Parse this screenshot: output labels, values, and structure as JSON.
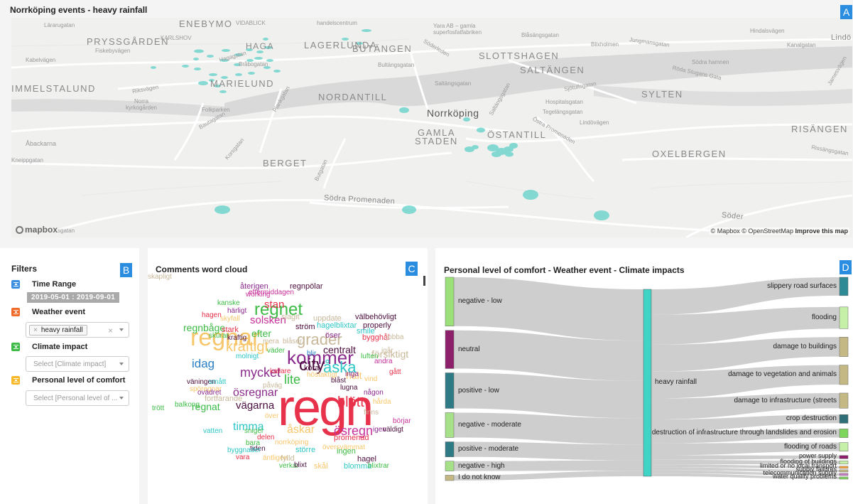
{
  "page_title": "Norrköping events - heavy rainfall",
  "badges": {
    "a": "A",
    "b": "B",
    "c": "C",
    "d": "D"
  },
  "map": {
    "labels": [
      "ENEBYMO",
      "VIDABLICK",
      "PRYSSGÅRDEN",
      "KARLSHOV",
      "HAGA",
      "LAGERLUNDA",
      "BUTÄNGEN",
      "SLOTTSHAGEN",
      "SALTÄNGEN",
      "IMMELSTALUND",
      "MARIELUND",
      "NORDANTILL",
      "SYLTEN",
      "GAMLA",
      "STADEN",
      "ÖSTANTILL",
      "RISÄNGEN",
      "OXELBERGEN",
      "BERGET",
      "Åbackarna"
    ],
    "small_labels": [
      "Lärarugatan",
      "Kabelvägen",
      "Fiskebyvägen",
      "Riksvägen",
      "Norra kyrkogården",
      "Folkparken",
      "Bråbogatan",
      "Hagagatan",
      "Kneippgatan",
      "Korsgatan",
      "Butgatan",
      "Plankgatan",
      "Sjötullsgatan",
      "Hospitalsgatan",
      "Tegelängsgatan",
      "Lindövägen",
      "Östra Promenaden",
      "Södra Promenaden",
      "Södra hamnen",
      "Röda Stugans Gata",
      "Blixholmen",
      "Jungmansgatan",
      "Bultängsgatan",
      "Saltängsgatan",
      "Rissängsgatan",
      "Kanalgatan",
      "Lindö",
      "Blåsängsgatan",
      "Söder",
      "handelscentrum",
      "Yara AB – gamla superfosfatfabriken",
      "Söderleden",
      "Hindalsvägen",
      "Jamesvägen",
      "Saltängsgatan",
      "Bautagatan",
      "Norrköping"
    ],
    "city": "Norrköping",
    "attribution_prefix": "© Mapbox © OpenStreetMap",
    "attribution_link": "Improve this map",
    "logo": "mapbox",
    "logo_tail": "sgatan",
    "point_color": "#5fd0c8"
  },
  "filters": {
    "title": "Filters",
    "time_range_label": "Time Range",
    "time_range_value": "2019-05-01 : 2019-09-01",
    "weather_label": "Weather event",
    "weather_chip": "heavy rainfall",
    "climate_label": "Climate impact",
    "climate_placeholder": "Select [Climate impact]",
    "comfort_label": "Personal level of comfort",
    "comfort_placeholder": "Select [Personal level of ..."
  },
  "wordcloud": {
    "title": "Comments word cloud",
    "words": [
      {
        "t": "regn",
        "c": "#e8314a"
      },
      {
        "t": "regnar",
        "c": "#f7c66b"
      },
      {
        "t": "regnet",
        "c": "#3dbb46"
      },
      {
        "t": "kommer",
        "c": "#8a2a8c"
      },
      {
        "t": "city",
        "c": "#4b0d3d"
      },
      {
        "t": "åska",
        "c": "#2ec6c6"
      },
      {
        "t": "grader",
        "c": "#c8b89a"
      },
      {
        "t": "blött",
        "c": "#e8314a"
      },
      {
        "t": "kraftigt",
        "c": "#f7c66b"
      },
      {
        "t": "mycket",
        "c": "#8a2a8c"
      },
      {
        "t": "lite",
        "c": "#3dbb46"
      },
      {
        "t": "solsken",
        "c": "#c8319a"
      },
      {
        "t": "stan",
        "c": "#e8314a"
      },
      {
        "t": "idag",
        "c": "#2b7fc4"
      },
      {
        "t": "efter",
        "c": "#3dbb46"
      },
      {
        "t": "centralt",
        "c": "#4b0d3d"
      },
      {
        "t": "försiktigt",
        "c": "#c8b89a"
      },
      {
        "t": "halt",
        "c": "#f7c66b"
      },
      {
        "t": "ösregnar",
        "c": "#8a2a8c"
      },
      {
        "t": "vägarna",
        "c": "#4b0d3d"
      },
      {
        "t": "timma",
        "c": "#2ec6c6"
      },
      {
        "t": "åskar",
        "c": "#f7c66b"
      },
      {
        "t": "ösregn",
        "c": "#c8319a"
      },
      {
        "t": "regnbåge",
        "c": "#3dbb46"
      },
      {
        "t": "regnpölar",
        "c": "#4b0d3d"
      },
      {
        "t": "återigen",
        "c": "#8a2a8c"
      },
      {
        "t": "eftermiddagen",
        "c": "#c8319a"
      },
      {
        "t": "working",
        "c": "#c8319a"
      },
      {
        "t": "kanske",
        "c": "#3dbb46"
      },
      {
        "t": "härligt",
        "c": "#8a2a8c"
      },
      {
        "t": "hagen",
        "c": "#e8314a"
      },
      {
        "t": "skyfall",
        "c": "#f7c66b"
      },
      {
        "t": "slagit",
        "c": "#c8b89a"
      },
      {
        "t": "uppdate",
        "c": "#c8b89a"
      },
      {
        "t": "välbehövligt",
        "c": "#4b0d3d"
      },
      {
        "t": "hagelblixtar",
        "c": "#2ec6c6"
      },
      {
        "t": "properly",
        "c": "#4b0d3d"
      },
      {
        "t": "smile",
        "c": "#2ec6c6"
      },
      {
        "t": "ström",
        "c": "#4b0d3d"
      },
      {
        "t": "öser",
        "c": "#8a2a8c"
      },
      {
        "t": "bygghål",
        "c": "#e8314a"
      },
      {
        "t": "jobba",
        "c": "#c8b89a"
      },
      {
        "t": "stark",
        "c": "#e8314a"
      },
      {
        "t": "kraftig",
        "c": "#4b0d3d"
      },
      {
        "t": "skurar",
        "c": "#3dbb46"
      },
      {
        "t": "mera",
        "c": "#c8b89a"
      },
      {
        "t": "blåser",
        "c": "#c8b89a"
      },
      {
        "t": "igår",
        "c": "#c8b89a"
      },
      {
        "t": "väder",
        "c": "#3dbb46"
      },
      {
        "t": "blir",
        "c": "#2b7fc4"
      },
      {
        "t": "luften",
        "c": "#3dbb46"
      },
      {
        "t": "andra",
        "c": "#c8319a"
      },
      {
        "t": "molnigt",
        "c": "#2ec6c6"
      },
      {
        "t": "kallare",
        "c": "#e8314a"
      },
      {
        "t": "köra",
        "c": "#4b0d3d"
      },
      {
        "t": "gått",
        "c": "#e8314a"
      },
      {
        "t": "väningen",
        "c": "#4b0d3d"
      },
      {
        "t": "smått",
        "c": "#2ec6c6"
      },
      {
        "t": "höstaktigt",
        "c": "#f7c66b"
      },
      {
        "t": "blåst",
        "c": "#4b0d3d"
      },
      {
        "t": "inga",
        "c": "#8a2a8c"
      },
      {
        "t": "vind",
        "c": "#f7c66b"
      },
      {
        "t": "trött",
        "c": "#3dbb46"
      },
      {
        "t": "spöregnar",
        "c": "#f7c66b"
      },
      {
        "t": "påväg",
        "c": "#c8b89a"
      },
      {
        "t": "lugna",
        "c": "#4b0d3d"
      },
      {
        "t": "ovädret",
        "c": "#8a2a8c"
      },
      {
        "t": "fortfarande",
        "c": "#c8b89a"
      },
      {
        "t": "någon",
        "c": "#8a2a8c"
      },
      {
        "t": "hårda",
        "c": "#f7c66b"
      },
      {
        "t": "balkong",
        "c": "#3dbb46"
      },
      {
        "t": "regnat",
        "c": "#3dbb46"
      },
      {
        "t": "över",
        "c": "#f7c66b"
      },
      {
        "t": "finns",
        "c": "#c8b89a"
      },
      {
        "t": "börjar",
        "c": "#c8319a"
      },
      {
        "t": "vatten",
        "c": "#2ec6c6"
      },
      {
        "t": "snigel",
        "c": "#3dbb46"
      },
      {
        "t": "delen",
        "c": "#e8314a"
      },
      {
        "t": "promenad",
        "c": "#e8314a"
      },
      {
        "t": "igen",
        "c": "#8a2a8c"
      },
      {
        "t": "väldigt",
        "c": "#4b0d3d"
      },
      {
        "t": "bara",
        "c": "#3dbb46"
      },
      {
        "t": "tiden",
        "c": "#4b0d3d"
      },
      {
        "t": "norrköping",
        "c": "#f7c66b"
      },
      {
        "t": "översvämmat",
        "c": "#f7c66b"
      },
      {
        "t": "större",
        "c": "#2ec6c6"
      },
      {
        "t": "ingen",
        "c": "#3dbb46"
      },
      {
        "t": "hagel",
        "c": "#4b0d3d"
      },
      {
        "t": "byggnader",
        "c": "#2ec6c6"
      },
      {
        "t": "äntligen",
        "c": "#f7c66b"
      },
      {
        "t": "fylld",
        "c": "#c8b89a"
      },
      {
        "t": "vara",
        "c": "#e8314a"
      },
      {
        "t": "verkar",
        "c": "#3dbb46"
      },
      {
        "t": "blixt",
        "c": "#4b0d3d"
      },
      {
        "t": "skål",
        "c": "#f7c66b"
      },
      {
        "t": "blomma",
        "c": "#2ec6c6"
      },
      {
        "t": "blixtrar",
        "c": "#3dbb46"
      },
      {
        "t": "skapligt",
        "c": "#c8b89a"
      }
    ]
  },
  "sankey": {
    "title": "Personal level of comfort - Weather event - Climate impacts",
    "left": [
      {
        "label": "negative - low",
        "color": "#9be078",
        "value": 55
      },
      {
        "label": "neutral",
        "color": "#8e1f6a",
        "value": 43
      },
      {
        "label": "positive - low",
        "color": "#2e7a85",
        "value": 40
      },
      {
        "label": "negative - moderate",
        "color": "#a6e088",
        "value": 28
      },
      {
        "label": "positive - moderate",
        "color": "#2e7a85",
        "value": 17
      },
      {
        "label": "negative - high",
        "color": "#a6e088",
        "value": 11
      },
      {
        "label": "I do not know",
        "color": "#c4b884",
        "value": 6
      }
    ],
    "middle": {
      "label": "heavy rainfall",
      "color": "#40d4c6"
    },
    "right": [
      {
        "label": "slippery road surfaces",
        "color": "#2e8b95",
        "value": 17
      },
      {
        "label": "flooding",
        "color": "#c6f0a8",
        "value": 20
      },
      {
        "label": "damage to buildings",
        "color": "#c4b884",
        "value": 18
      },
      {
        "label": "damage to vegetation and animals",
        "color": "#c4b884",
        "value": 18
      },
      {
        "label": "damage to infrastructure (streets",
        "color": "#c4b884",
        "value": 14
      },
      {
        "label": "crop destruction",
        "color": "#2e6f78",
        "value": 8
      },
      {
        "label": "destruction of infrastructure through landslides and erosion",
        "color": "#7ed65a",
        "value": 8
      },
      {
        "label": "flooding of roads",
        "color": "#c6f0a8",
        "value": 8
      },
      {
        "label": "power supply",
        "color": "#8e1f6a",
        "value": 3
      },
      {
        "label": "flooding of buildings",
        "color": "#c6f0a8",
        "value": 3
      },
      {
        "label": "limited or no local transport",
        "color": "#f7a33c",
        "value": 2
      },
      {
        "label": "supply failures",
        "color": "#c4b884",
        "value": 2
      },
      {
        "label": "telecommunication supply",
        "color": "#c77bc0",
        "value": 2
      },
      {
        "label": "water quality problems",
        "color": "#7ed65a",
        "value": 2
      }
    ]
  }
}
